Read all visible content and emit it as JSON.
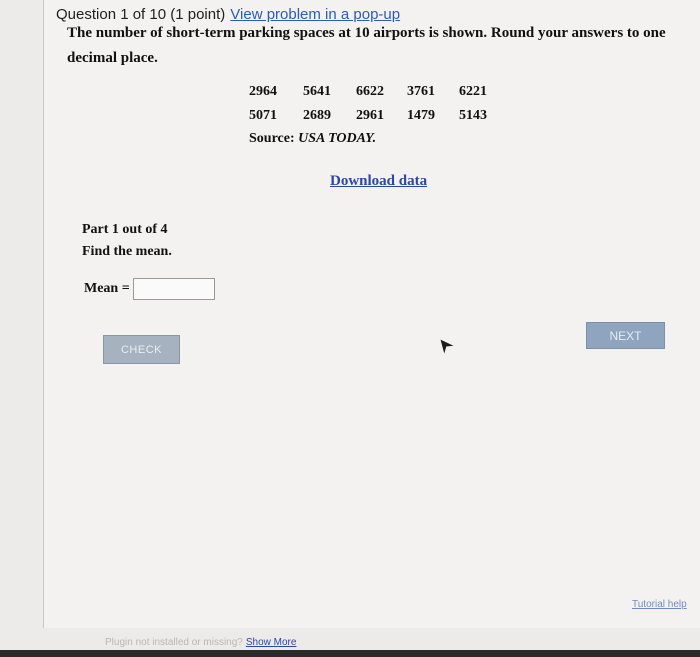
{
  "header": {
    "question_label": "Question 1 of 10 (1 point)",
    "popup_link": "View problem in a pop-up"
  },
  "problem": {
    "prompt": "The number of short-term parking spaces at 10 airports is shown. Round your answers to one decimal place.",
    "data_rows": [
      [
        "2964",
        "5641",
        "6622",
        "3761",
        "6221"
      ],
      [
        "5071",
        "2689",
        "2961",
        "1479",
        "5143"
      ]
    ],
    "source_label": "Source:",
    "source_name": "USA TODAY.",
    "download_link": "Download data"
  },
  "part": {
    "title": "Part 1 out of 4",
    "instruction": "Find the mean."
  },
  "answer": {
    "label": "Mean =",
    "value": ""
  },
  "buttons": {
    "check": "CHECK",
    "next": "NEXT"
  },
  "footer": {
    "tutorial": "Tutorial help",
    "plugin_text": "Plugin not installed or missing?",
    "show_more": "Show More"
  }
}
